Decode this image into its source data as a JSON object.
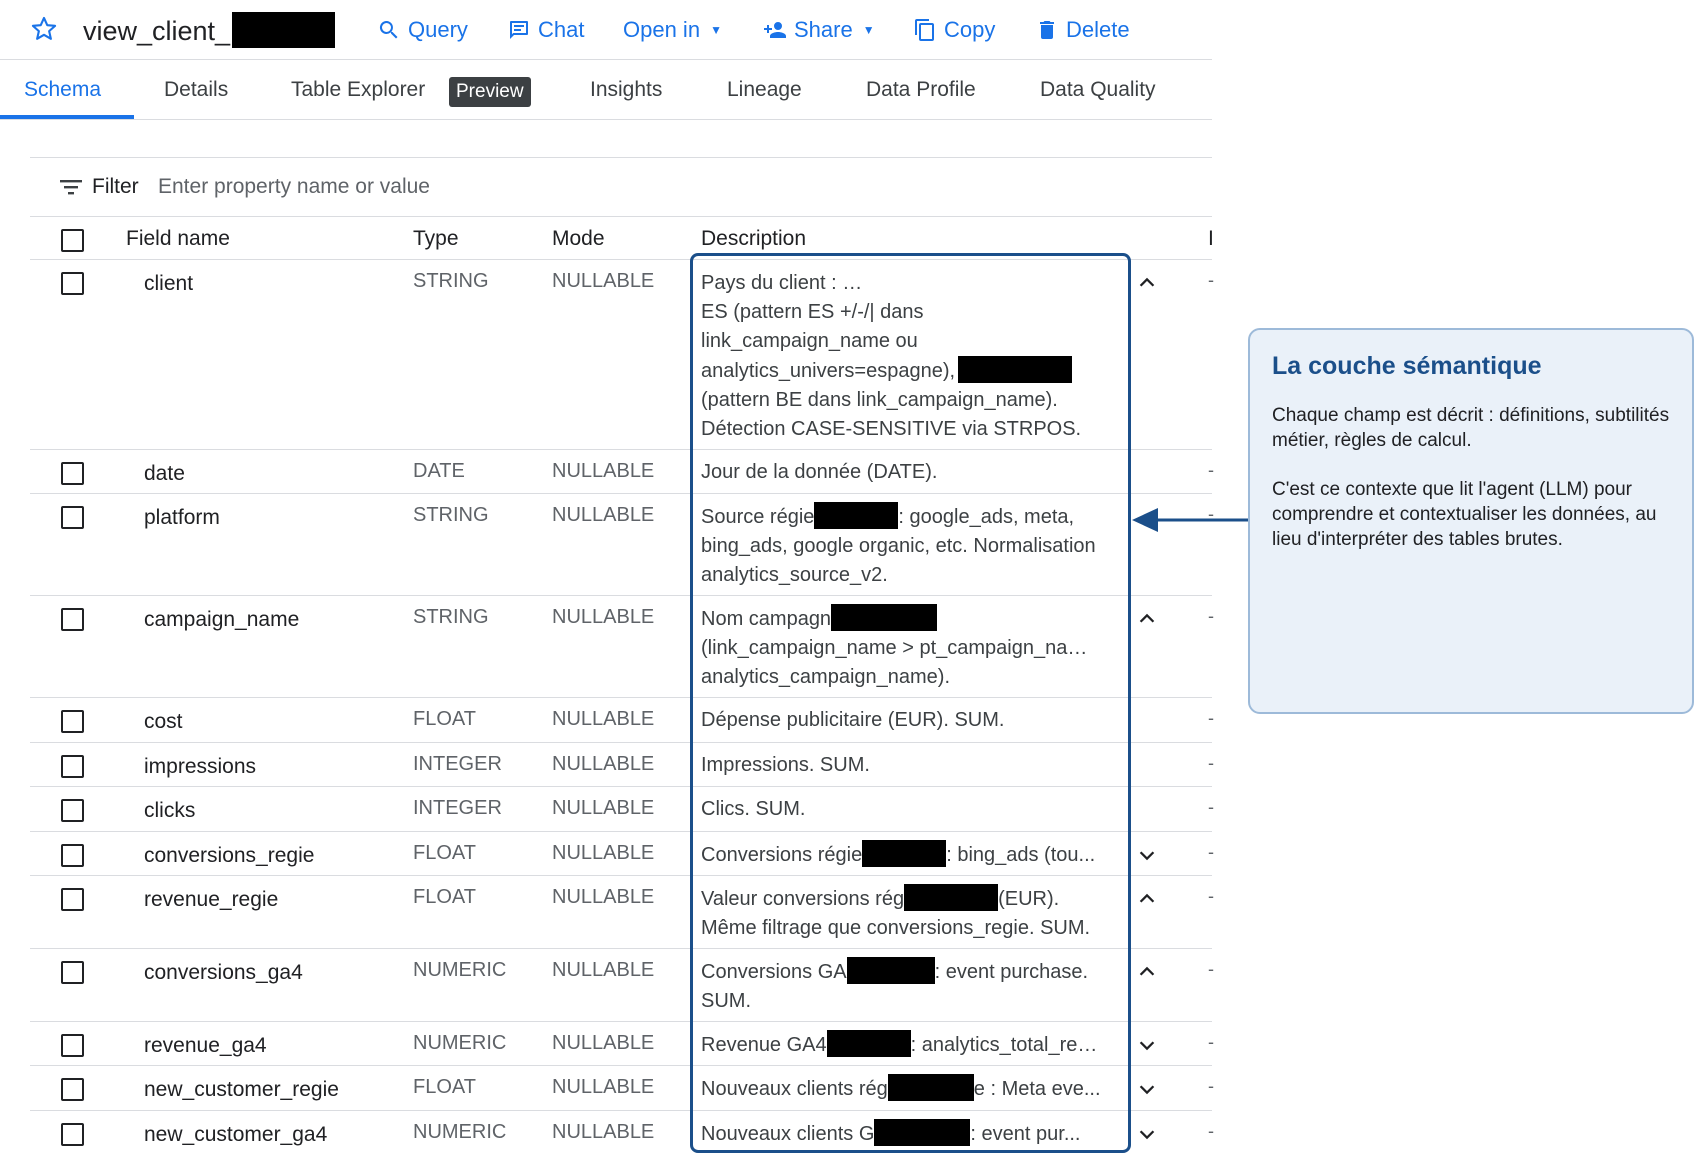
{
  "header": {
    "title": "view_client_",
    "actions": {
      "query": "Query",
      "chat": "Chat",
      "open_in": "Open in",
      "share": "Share",
      "copy": "Copy",
      "delete": "Delete"
    }
  },
  "tabs": {
    "schema": "Schema",
    "details": "Details",
    "table_explorer": "Table Explorer",
    "preview_badge": "Preview",
    "insights": "Insights",
    "lineage": "Lineage",
    "data_profile": "Data Profile",
    "data_quality": "Data Quality",
    "active": "Schema"
  },
  "filter": {
    "label": "Filter",
    "placeholder": "Enter property name or value"
  },
  "table": {
    "headers": {
      "field_name": "Field name",
      "type": "Type",
      "mode": "Mode",
      "description": "Description",
      "cut_column": "I"
    },
    "rows": [
      {
        "name": "client",
        "type": "STRING",
        "mode": "NULLABLE",
        "chevron": "up",
        "desc": [
          "Pays du client : ",
          "ES (pattern ES +/-/| dans",
          "link_campaign_name ou",
          "analytics_univers=espagne),",
          "(pattern BE dans link_campaign_name).",
          "Détection CASE-SENSITIVE via STRPOS."
        ]
      },
      {
        "name": "date",
        "type": "DATE",
        "mode": "NULLABLE",
        "chevron": "",
        "desc": [
          "Jour de la donnée (DATE)."
        ]
      },
      {
        "name": "platform",
        "type": "STRING",
        "mode": "NULLABLE",
        "chevron": "",
        "desc": [
          "Source régie",
          ": google_ads, meta,",
          "bing_ads, google organic, etc. Normalisation",
          "analytics_source_v2."
        ]
      },
      {
        "name": "campaign_name",
        "type": "STRING",
        "mode": "NULLABLE",
        "chevron": "up",
        "desc": [
          "Nom campagn",
          "(link_campaign_name > pt_campaign_name >",
          "analytics_campaign_name)."
        ]
      },
      {
        "name": "cost",
        "type": "FLOAT",
        "mode": "NULLABLE",
        "chevron": "",
        "desc": [
          "Dépense publicitaire (EUR). SUM."
        ]
      },
      {
        "name": "impressions",
        "type": "INTEGER",
        "mode": "NULLABLE",
        "chevron": "",
        "desc": [
          "Impressions. SUM."
        ]
      },
      {
        "name": "clicks",
        "type": "INTEGER",
        "mode": "NULLABLE",
        "chevron": "",
        "desc": [
          "Clics. SUM."
        ]
      },
      {
        "name": "conversions_regie",
        "type": "FLOAT",
        "mode": "NULLABLE",
        "chevron": "down",
        "desc": [
          "Conversions régie",
          ": bing_ads (tou..."
        ]
      },
      {
        "name": "revenue_regie",
        "type": "FLOAT",
        "mode": "NULLABLE",
        "chevron": "up",
        "desc": [
          "Valeur conversions rég",
          "(EUR).",
          "Même filtrage que conversions_regie. SUM."
        ]
      },
      {
        "name": "conversions_ga4",
        "type": "NUMERIC",
        "mode": "NULLABLE",
        "chevron": "up",
        "desc": [
          "Conversions GA",
          ": event purchase.",
          "SUM."
        ]
      },
      {
        "name": "revenue_ga4",
        "type": "NUMERIC",
        "mode": "NULLABLE",
        "chevron": "down",
        "desc": [
          "Revenue GA4",
          ": analytics_total_rev..."
        ]
      },
      {
        "name": "new_customer_regie",
        "type": "FLOAT",
        "mode": "NULLABLE",
        "chevron": "down",
        "desc": [
          "Nouveaux clients rég",
          "e : Meta eve..."
        ]
      },
      {
        "name": "new_customer_ga4",
        "type": "NUMERIC",
        "mode": "NULLABLE",
        "chevron": "down",
        "desc": [
          "Nouveaux clients G",
          ": event pur..."
        ]
      }
    ]
  },
  "callout": {
    "title": "La couche sémantique",
    "p1": "Chaque champ est décrit : définitions, subtilités métier, règles de calcul.",
    "p2": "C'est ce contexte que lit l'agent (LLM) pour comprendre et contextualiser les données, au lieu d'interpréter des tables brutes."
  },
  "colors": {
    "accent": "#1a73e8",
    "highlight_border": "#1b4f8a",
    "callout_bg": "#eaf1f9",
    "callout_border": "#9dbad9"
  }
}
